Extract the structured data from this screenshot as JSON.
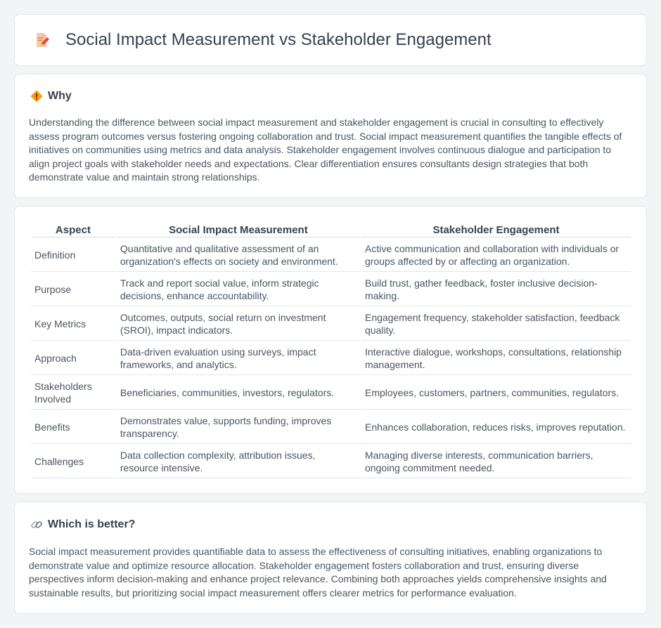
{
  "header": {
    "title": "Social Impact Measurement vs Stakeholder Engagement",
    "icon": "document-edit-icon"
  },
  "why": {
    "icon": "diamond-alert-icon",
    "heading": "Why",
    "text": "Understanding the difference between social impact measurement and stakeholder engagement is crucial in consulting to effectively assess program outcomes versus fostering ongoing collaboration and trust. Social impact measurement quantifies the tangible effects of initiatives on communities using metrics and data analysis. Stakeholder engagement involves continuous dialogue and participation to align project goals with stakeholder needs and expectations. Clear differentiation ensures consultants design strategies that both demonstrate value and maintain strong relationships."
  },
  "comparison": {
    "columns": [
      "Aspect",
      "Social Impact Measurement",
      "Stakeholder Engagement"
    ],
    "rows": [
      {
        "aspect": "Definition",
        "sim": "Quantitative and qualitative assessment of an organization's effects on society and environment.",
        "se": "Active communication and collaboration with individuals or groups affected by or affecting an organization."
      },
      {
        "aspect": "Purpose",
        "sim": "Track and report social value, inform strategic decisions, enhance accountability.",
        "se": "Build trust, gather feedback, foster inclusive decision-making."
      },
      {
        "aspect": "Key Metrics",
        "sim": "Outcomes, outputs, social return on investment (SROI), impact indicators.",
        "se": "Engagement frequency, stakeholder satisfaction, feedback quality."
      },
      {
        "aspect": "Approach",
        "sim": "Data-driven evaluation using surveys, impact frameworks, and analytics.",
        "se": "Interactive dialogue, workshops, consultations, relationship management."
      },
      {
        "aspect": "Stakeholders Involved",
        "sim": "Beneficiaries, communities, investors, regulators.",
        "se": "Employees, customers, partners, communities, regulators."
      },
      {
        "aspect": "Benefits",
        "sim": "Demonstrates value, supports funding, improves transparency.",
        "se": "Enhances collaboration, reduces risks, improves reputation."
      },
      {
        "aspect": "Challenges",
        "sim": "Data collection complexity, attribution issues, resource intensive.",
        "se": "Managing diverse interests, communication barriers, ongoing commitment needed."
      }
    ]
  },
  "better": {
    "icon": "link-icon",
    "heading": "Which is better?",
    "text": "Social impact measurement provides quantifiable data to assess the effectiveness of consulting initiatives, enabling organizations to demonstrate value and optimize resource allocation. Stakeholder engagement fosters collaboration and trust, ensuring diverse perspectives inform decision-making and enhance project relevance. Combining both approaches yields comprehensive insights and sustainable results, but prioritizing social impact measurement offers clearer metrics for performance evaluation."
  },
  "colors": {
    "background": "#f3f4f6",
    "card": "#ffffff",
    "text": "#374151",
    "icon_orange": "#f59e0b",
    "icon_red": "#ef4444"
  }
}
